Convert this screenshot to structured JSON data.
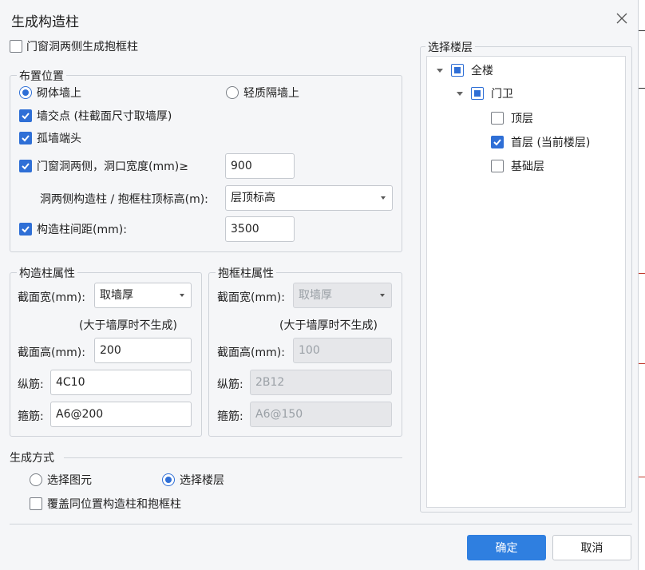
{
  "dialog": {
    "title": "生成构造柱",
    "close_icon": "close-icon"
  },
  "top_option": {
    "label": "门窗洞两侧生成抱框柱",
    "checked": false
  },
  "placement": {
    "title": "布置位置",
    "radio_masonry": {
      "label": "砌体墙上",
      "selected": true
    },
    "radio_light": {
      "label": "轻质隔墙上",
      "selected": false
    },
    "wall_intersection": {
      "label": "墙交点 (柱截面尺寸取墙厚)",
      "checked": true
    },
    "isolated_wall_end": {
      "label": "孤墙端头",
      "checked": true
    },
    "opening_sides": {
      "label": "门窗洞两侧，洞口宽度(mm)≥",
      "checked": true,
      "value": "900"
    },
    "top_elevation": {
      "label": "洞两侧构造柱 / 抱框柱顶标高(m):",
      "value": "层顶标高"
    },
    "spacing": {
      "label": "构造柱间距(mm):",
      "checked": true,
      "value": "3500"
    }
  },
  "column_props": {
    "title": "构造柱属性",
    "width_label": "截面宽(mm):",
    "width_value": "取墙厚",
    "note": "(大于墙厚时不生成)",
    "height_label": "截面高(mm):",
    "height_value": "200",
    "long_bar_label": "纵筋:",
    "long_bar_value": "4C10",
    "stirrup_label": "箍筋:",
    "stirrup_value": "A6@200"
  },
  "frame_props": {
    "title": "抱框柱属性",
    "width_label": "截面宽(mm):",
    "width_value": "取墙厚",
    "note": "(大于墙厚时不生成)",
    "height_label": "截面高(mm):",
    "height_value": "100",
    "long_bar_label": "纵筋:",
    "long_bar_value": "2B12",
    "stirrup_label": "箍筋:",
    "stirrup_value": "A6@150"
  },
  "generate_mode": {
    "title": "生成方式",
    "radio_elements": {
      "label": "选择图元",
      "selected": false
    },
    "radio_floors": {
      "label": "选择楼层",
      "selected": true
    },
    "overwrite": {
      "label": "覆盖同位置构造柱和抱框柱",
      "checked": false
    }
  },
  "floors": {
    "title": "选择楼层",
    "root": {
      "label": "全楼",
      "state": "partial"
    },
    "building": {
      "label": "门卫",
      "state": "partial"
    },
    "items": [
      {
        "label": "顶层",
        "checked": false
      },
      {
        "label": "首层 (当前楼层)",
        "checked": true
      },
      {
        "label": "基础层",
        "checked": false
      }
    ]
  },
  "buttons": {
    "ok": "确定",
    "cancel": "取消"
  },
  "colors": {
    "accent": "#2f7fe0",
    "check": "#2f6fd6"
  }
}
